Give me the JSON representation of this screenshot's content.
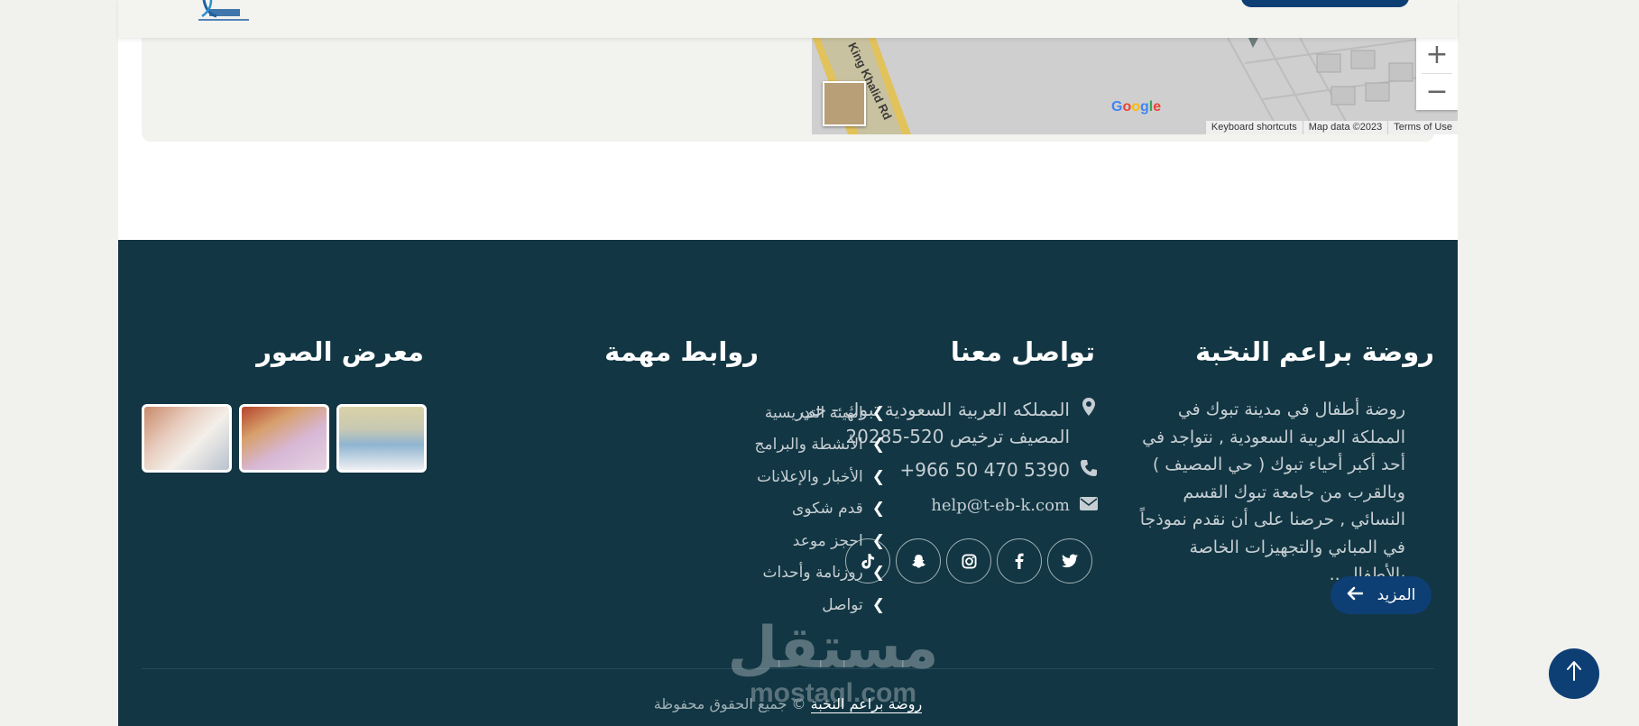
{
  "map": {
    "zoom_in": "+",
    "zoom_out": "−",
    "road_label": "King Khalid Rd",
    "google_logo": "Google",
    "attribution": [
      "Keyboard shortcuts",
      "Map data ©2023",
      "Terms of Use"
    ]
  },
  "footer": {
    "about": {
      "title": "روضة براعم النخبة",
      "text": "روضة أطفال في مدينة تبوك في المملكة العربية السعودية , نتواجد في أحد أكبر أحياء تبوك ( حي المصيف ) وبالقرب من جامعة تبوك القسم النسائي , حرصنا على أن نقدم نموذجاً في المباني والتجهيزات الخاصة بالأطفال...",
      "more_label": "المزيد"
    },
    "contact": {
      "title": "تواصل معنا",
      "address": "المملكه العربية السعودية تبوك - حي المصيف ترخيص 520-20285",
      "phone": "+966 50 470 5390",
      "email": "help@t-eb-k.com",
      "social": [
        "twitter-icon",
        "facebook-icon",
        "instagram-icon",
        "snapchat-icon",
        "tiktok-icon"
      ]
    },
    "links": {
      "title": "روابط مهمة",
      "items": [
        "الهيئة التدريسية",
        "الأنشطة والبرامج",
        "الأخبار والإعلانات",
        "قدم شكوى",
        "احجز موعد",
        "روزنامة وأحداث",
        "تواصل"
      ]
    },
    "gallery": {
      "title": "معرض الصور",
      "images": [
        "kids-table-photo",
        "child-painting-photo",
        "children-drawing-photo"
      ]
    },
    "copyright": {
      "site_name": "روضة براعم النخبة",
      "rest": "© جميع الحقوق محفوظة"
    }
  },
  "watermark": {
    "arabic": "مستقل",
    "latin": "mostaql.com"
  },
  "colors": {
    "footer_bg": "#123643",
    "primary": "#0d3f74",
    "page_bg": "#f1f1ee"
  }
}
